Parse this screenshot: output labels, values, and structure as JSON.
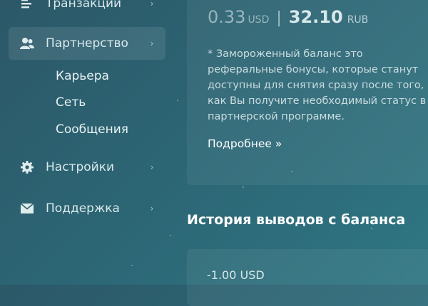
{
  "sidebar": {
    "items": [
      {
        "label": "Транзакции",
        "icon": "transactions-icon",
        "chevron": "›"
      },
      {
        "label": "Партнерство",
        "icon": "partners-icon",
        "chevron": "›",
        "active": true,
        "subitems": [
          "Карьера",
          "Сеть",
          "Сообщения"
        ]
      },
      {
        "label": "Настройки",
        "icon": "gear-icon",
        "chevron": "›"
      },
      {
        "label": "Поддержка",
        "icon": "mail-icon",
        "chevron": "›"
      }
    ]
  },
  "balance": {
    "usd_value": "0.33",
    "usd_currency": "USD",
    "separator": "|",
    "rub_value": "32.10",
    "rub_currency": "RUB",
    "note": "* Замороженный баланс это реферальные бонусы, которые станут доступны для снятия сразу после того, как Вы получите необходимый статус в партнерской программе.",
    "more_link": "Подробнее »"
  },
  "withdrawals": {
    "title": "История выводов с баланса",
    "first_amount": "-1.00 USD"
  },
  "colors": {
    "background_start": "#2c5868",
    "background_end": "#2f7683",
    "text_primary": "#ffffff"
  }
}
